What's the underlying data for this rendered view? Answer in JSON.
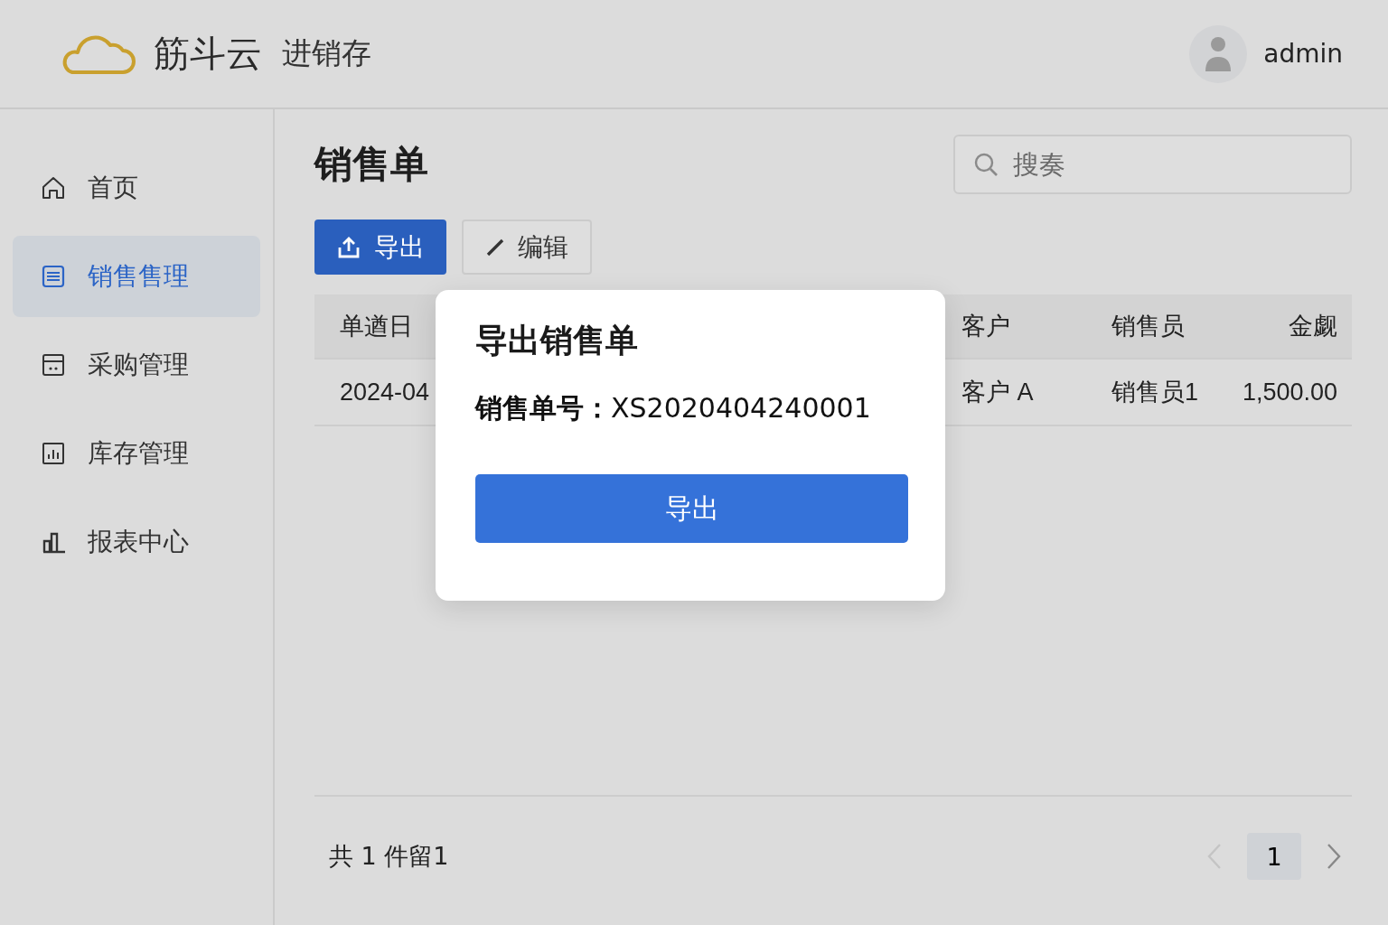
{
  "header": {
    "brand": "筋斗云",
    "product": "进销存",
    "user": "admin"
  },
  "sidebar": {
    "items": [
      {
        "label": "首页",
        "selected": false
      },
      {
        "label": "销售售理",
        "selected": true
      },
      {
        "label": "采购管理",
        "selected": false
      },
      {
        "label": "库存管理",
        "selected": false
      },
      {
        "label": "报表中心",
        "selected": false
      }
    ]
  },
  "page": {
    "title": "销售单",
    "search": {
      "placeholder": "搜奏"
    },
    "toolbar": [
      {
        "label": "导出",
        "kind": "primary"
      },
      {
        "label": "编辑",
        "kind": "default"
      }
    ],
    "table": {
      "columns": [
        "单遒日",
        "客户",
        "销售员",
        "金觑"
      ],
      "rows": [
        [
          "2024-04",
          "客户 A",
          "销售员1",
          "1,500.00"
        ]
      ]
    },
    "footer": {
      "total": "共 1 件留1",
      "pages": [
        {
          "label": "1",
          "selected": true
        }
      ],
      "prev_disabled": true,
      "next_disabled": false
    }
  },
  "dialog": {
    "title": "导出销售单",
    "body": "**销售单号：**XS2020404240001",
    "button": "导出"
  }
}
